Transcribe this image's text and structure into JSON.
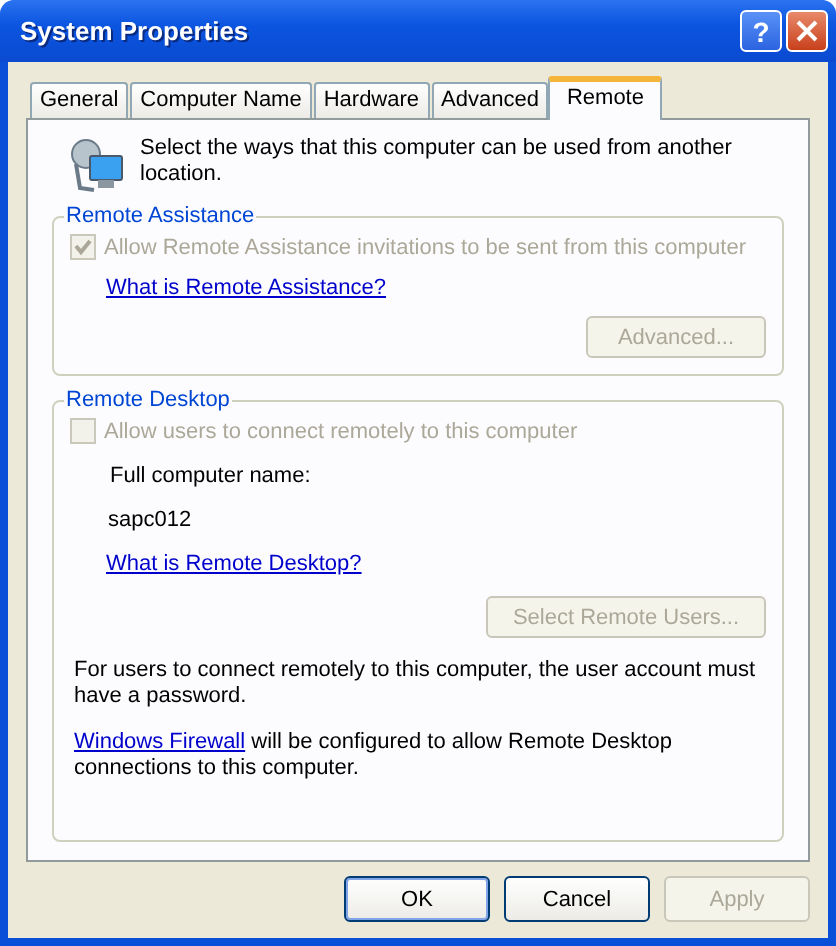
{
  "window": {
    "title": "System Properties",
    "help_button": "?"
  },
  "tabs": [
    {
      "label": "General",
      "selected": false
    },
    {
      "label": "Computer Name",
      "selected": false
    },
    {
      "label": "Hardware",
      "selected": false
    },
    {
      "label": "Advanced",
      "selected": false
    },
    {
      "label": "Remote",
      "selected": true
    }
  ],
  "intro": "Select the ways that this computer can be used from another location.",
  "remote_assistance": {
    "title": "Remote Assistance",
    "checkbox": {
      "label": "Allow Remote Assistance invitations to be sent from this computer",
      "checked": true,
      "disabled": true
    },
    "link": "What is Remote Assistance?",
    "button": {
      "label": "Advanced...",
      "disabled": true
    }
  },
  "remote_desktop": {
    "title": "Remote Desktop",
    "checkbox": {
      "label": "Allow users to connect remotely to this computer",
      "checked": false,
      "disabled": true
    },
    "name_label": "Full computer name:",
    "name_value": "sapc012",
    "link": "What is Remote Desktop?",
    "button": {
      "label": "Select Remote Users...",
      "disabled": true
    },
    "password_note": "For users to connect remotely to this computer, the user account must have a password.",
    "firewall_note": {
      "link": "Windows Firewall",
      "text": " will be configured to allow Remote Desktop connections to this computer."
    }
  },
  "buttons": [
    {
      "label": "OK",
      "disabled": false,
      "default": true
    },
    {
      "label": "Cancel",
      "disabled": false,
      "default": false
    },
    {
      "label": "Apply",
      "disabled": true,
      "default": false
    }
  ]
}
